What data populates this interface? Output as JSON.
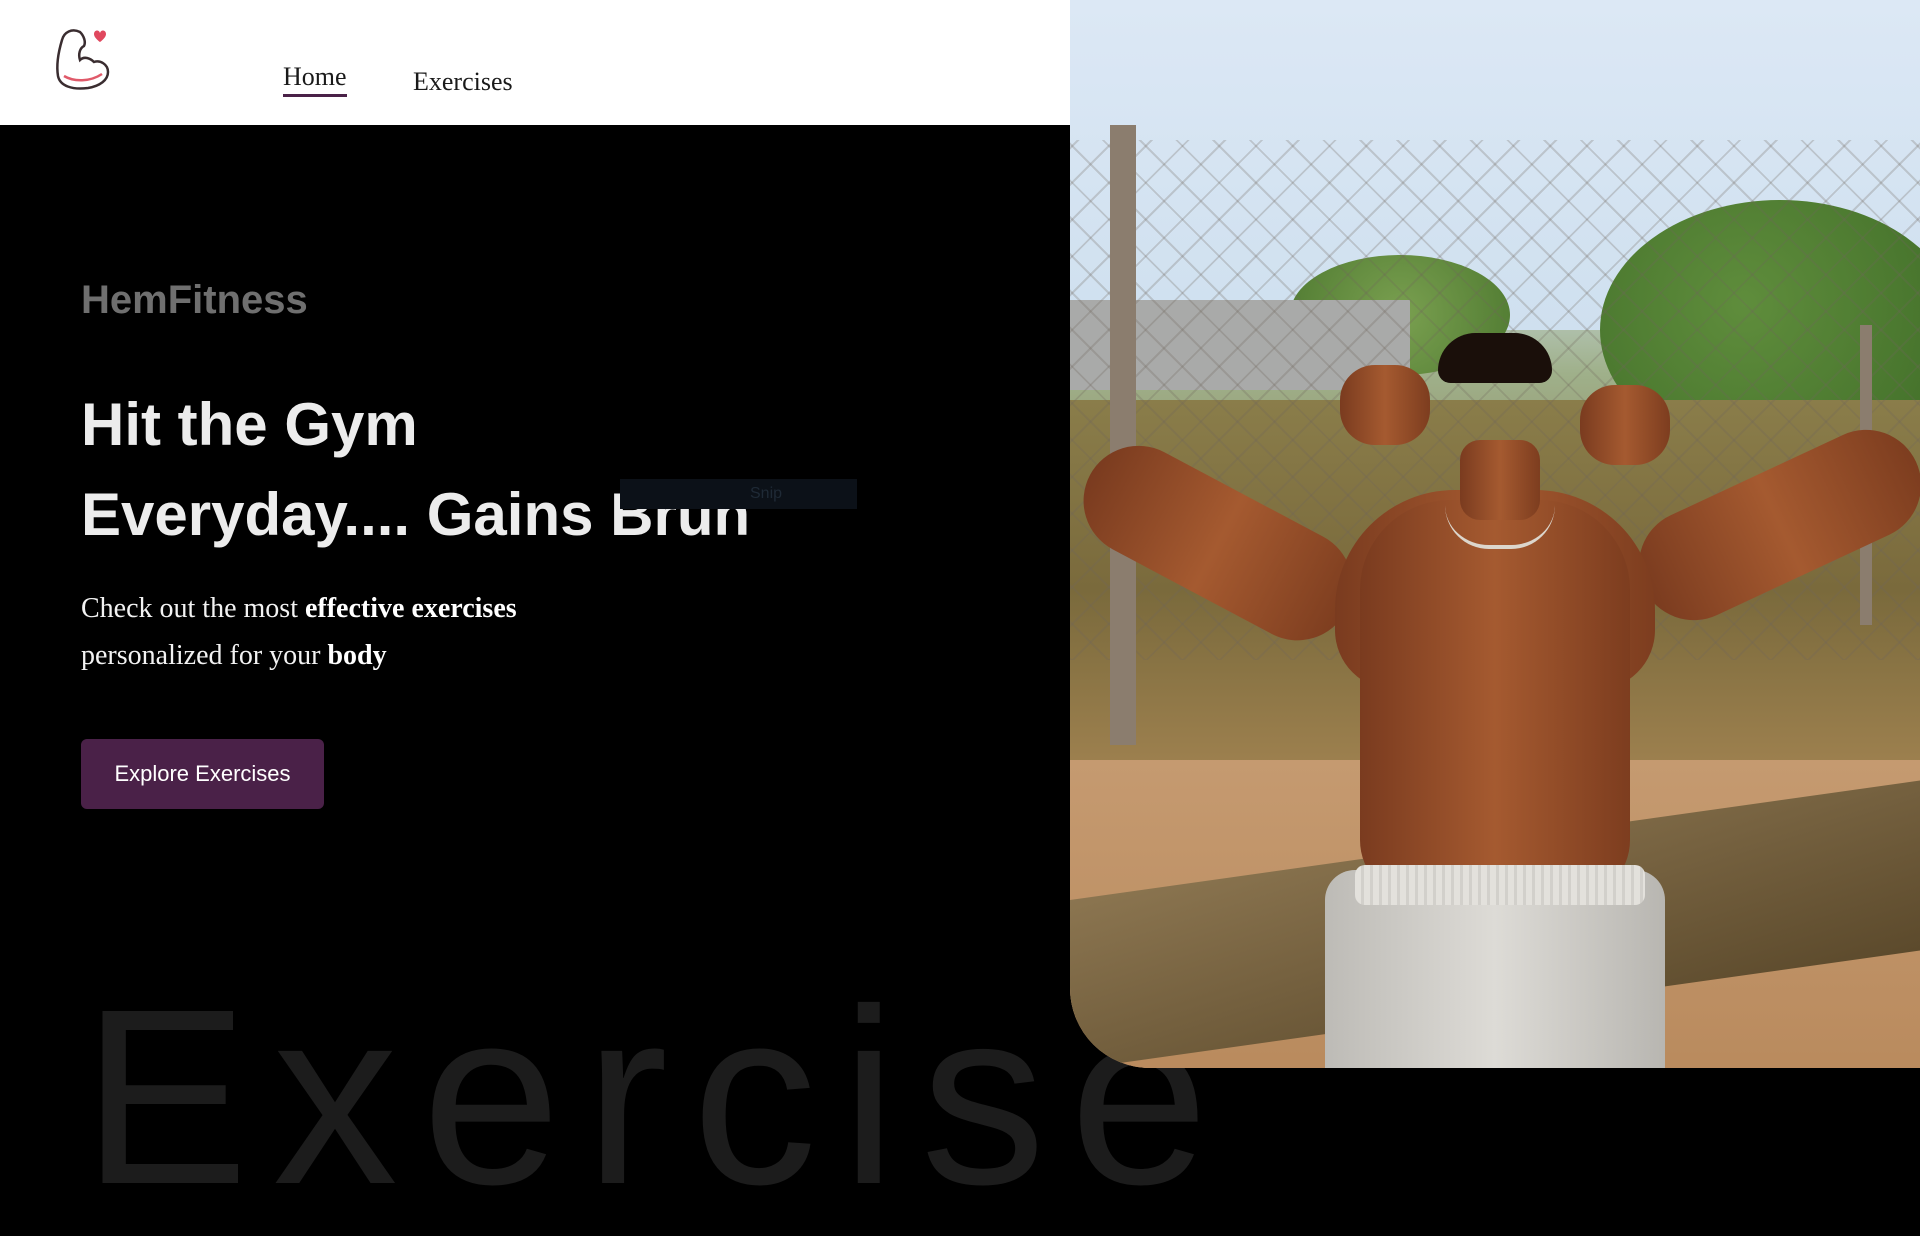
{
  "nav": {
    "logo_icon": "flexed-arm-heart-icon",
    "links": [
      {
        "label": "Home",
        "active": true
      },
      {
        "label": "Exercises",
        "active": false
      }
    ]
  },
  "hero": {
    "brand": "HemFitness",
    "headline_line1": "Hit the Gym",
    "headline_line2": "Everyday.... Gains Bruh",
    "sub_part1": "Check out the most ",
    "sub_bold1": "effective exercises",
    "sub_part2": "personalized for your ",
    "sub_bold2": "body",
    "cta_label": "Explore Exercises",
    "background_word": "Exercise",
    "overlay_text": "Snip"
  },
  "colors": {
    "accent": "#4a2148",
    "background": "#000000",
    "nav_background": "#ffffff",
    "brand_text": "#6f6f6f"
  }
}
